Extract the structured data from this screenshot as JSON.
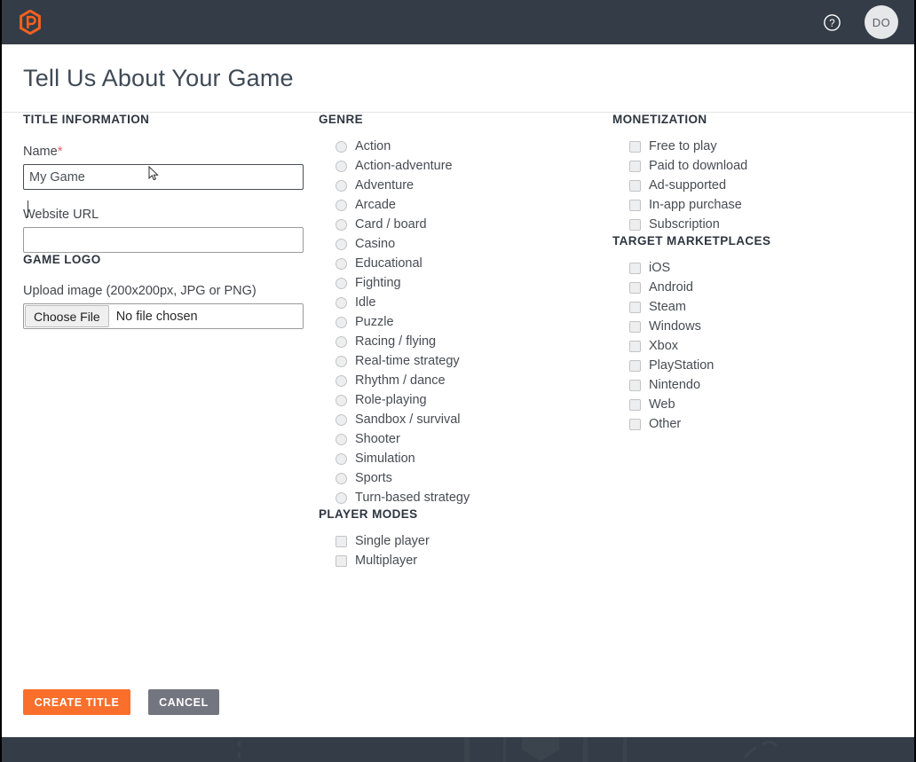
{
  "topbar": {
    "logo_icon": "hexagon-logo-icon",
    "help_icon": "help-circle-icon",
    "avatar_initials": "DO"
  },
  "page": {
    "title": "Tell Us About Your Game"
  },
  "title_information": {
    "heading": "TITLE INFORMATION",
    "name_label": "Name",
    "name_required_marker": "*",
    "name_value": "My Game",
    "website_label": "Website URL",
    "website_value": ""
  },
  "game_logo": {
    "heading": "GAME LOGO",
    "upload_label": "Upload image (200x200px, JPG or PNG)",
    "choose_file_button": "Choose File",
    "file_status": "No file chosen"
  },
  "genre": {
    "heading": "GENRE",
    "options": [
      {
        "label": "Action",
        "checked": false
      },
      {
        "label": "Action-adventure",
        "checked": false
      },
      {
        "label": "Adventure",
        "checked": false
      },
      {
        "label": "Arcade",
        "checked": false
      },
      {
        "label": "Card / board",
        "checked": false
      },
      {
        "label": "Casino",
        "checked": false
      },
      {
        "label": "Educational",
        "checked": false
      },
      {
        "label": "Fighting",
        "checked": false
      },
      {
        "label": "Idle",
        "checked": false
      },
      {
        "label": "Puzzle",
        "checked": false
      },
      {
        "label": "Racing / flying",
        "checked": false
      },
      {
        "label": "Real-time strategy",
        "checked": false
      },
      {
        "label": "Rhythm / dance",
        "checked": false
      },
      {
        "label": "Role-playing",
        "checked": false
      },
      {
        "label": "Sandbox / survival",
        "checked": false
      },
      {
        "label": "Shooter",
        "checked": false
      },
      {
        "label": "Simulation",
        "checked": false
      },
      {
        "label": "Sports",
        "checked": false
      },
      {
        "label": "Turn-based strategy",
        "checked": false
      }
    ]
  },
  "player_modes": {
    "heading": "PLAYER MODES",
    "options": [
      {
        "label": "Single player",
        "checked": false
      },
      {
        "label": "Multiplayer",
        "checked": false
      }
    ]
  },
  "monetization": {
    "heading": "MONETIZATION",
    "options": [
      {
        "label": "Free to play",
        "checked": false
      },
      {
        "label": "Paid to download",
        "checked": false
      },
      {
        "label": "Ad-supported",
        "checked": false
      },
      {
        "label": "In-app purchase",
        "checked": false
      },
      {
        "label": "Subscription",
        "checked": false
      }
    ]
  },
  "target_marketplaces": {
    "heading": "TARGET MARKETPLACES",
    "options": [
      {
        "label": "iOS",
        "checked": false
      },
      {
        "label": "Android",
        "checked": false
      },
      {
        "label": "Steam",
        "checked": false
      },
      {
        "label": "Windows",
        "checked": false
      },
      {
        "label": "Xbox",
        "checked": false
      },
      {
        "label": "PlayStation",
        "checked": false
      },
      {
        "label": "Nintendo",
        "checked": false
      },
      {
        "label": "Web",
        "checked": false
      },
      {
        "label": "Other",
        "checked": false
      }
    ]
  },
  "actions": {
    "create_label": "CREATE TITLE",
    "cancel_label": "CANCEL"
  },
  "colors": {
    "brand_orange": "#f96f2b",
    "topbar_dark": "#343d47",
    "cancel_gray": "#73757f",
    "required_red": "#ef5b6d"
  }
}
